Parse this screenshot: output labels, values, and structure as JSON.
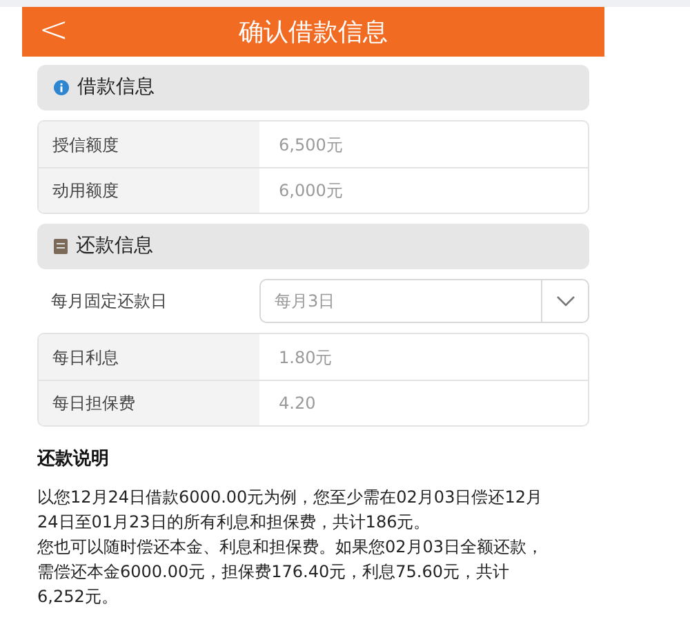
{
  "header": {
    "back": "<",
    "title": "确认借款信息"
  },
  "loan_section": {
    "title": "借款信息",
    "rows": [
      {
        "label": "授信额度",
        "value": "6,500元"
      },
      {
        "label": "动用额度",
        "value": "6,000元"
      }
    ]
  },
  "repay_section": {
    "title": "还款信息",
    "select": {
      "label": "每月固定还款日",
      "value": "每月3日"
    },
    "rows": [
      {
        "label": "每日利息",
        "value": "1.80元"
      },
      {
        "label": "每日担保费",
        "value": "4.20"
      }
    ]
  },
  "notes": {
    "title": "还款说明",
    "paragraphs": [
      "以您12月24日借款6000.00元为例，您至少需在02月03日偿还12月24日至01月23日的所有利息和担保费，共计186元。",
      "您也可以随时偿还本金、利息和担保费。如果您02月03日全额还款，需偿还本金6000.00元，担保费176.40元，利息75.60元，共计6,252元。"
    ]
  }
}
